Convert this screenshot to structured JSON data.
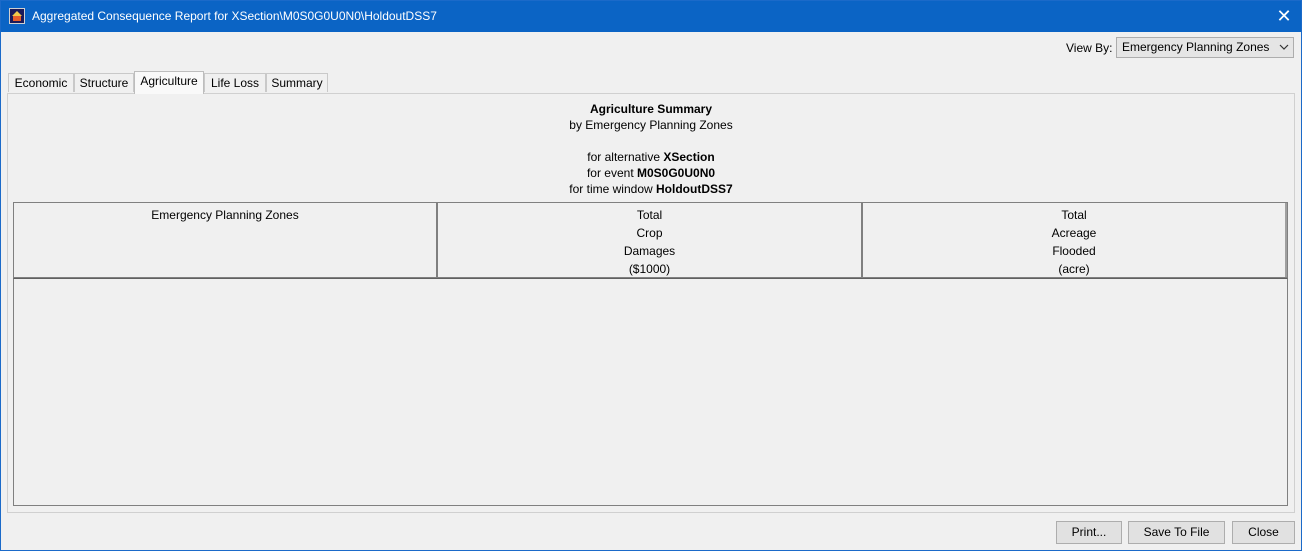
{
  "window": {
    "title": "Aggregated Consequence Report for XSection\\M0S0G0U0N0\\HoldoutDSS7"
  },
  "view_by": {
    "label": "View By:",
    "selected": "Emergency Planning Zones"
  },
  "tabs": [
    {
      "label": "Economic",
      "active": false
    },
    {
      "label": "Structure",
      "active": false
    },
    {
      "label": "Agriculture",
      "active": true
    },
    {
      "label": "Life Loss",
      "active": false
    },
    {
      "label": "Summary",
      "active": false
    }
  ],
  "summary": {
    "title": "Agriculture Summary",
    "subtitle": "by Emergency Planning Zones",
    "alt_prefix": "for alternative",
    "alt_value": "XSection",
    "event_prefix": "for event",
    "event_value": "M0S0G0U0N0",
    "window_prefix": "for time window",
    "window_value": "HoldoutDSS7"
  },
  "table": {
    "columns": [
      {
        "lines": [
          "Emergency Planning Zones"
        ]
      },
      {
        "lines": [
          "Total",
          "Crop",
          "Damages",
          "($1000)"
        ]
      },
      {
        "lines": [
          "Total",
          "Acreage",
          "Flooded",
          "(acre)"
        ]
      }
    ],
    "rows": []
  },
  "buttons": {
    "print": "Print...",
    "save": "Save To File",
    "close": "Close"
  }
}
